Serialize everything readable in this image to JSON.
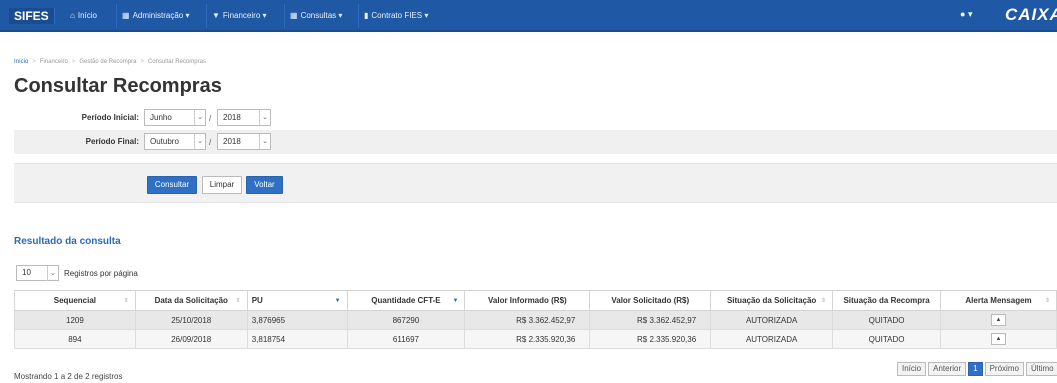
{
  "nav": {
    "brand": "SIFES",
    "items": [
      {
        "label": "Início",
        "icon": "home-icon"
      },
      {
        "label": "Administração ▾",
        "icon": "grid-icon"
      },
      {
        "label": "Financeiro ▾",
        "icon": "cart-icon"
      },
      {
        "label": "Consultas ▾",
        "icon": "table-icon"
      },
      {
        "label": "Contrato FIES ▾",
        "icon": "barcode-icon"
      }
    ],
    "user_label": "▾",
    "logo": "CAIXA"
  },
  "breadcrumb": [
    "Início",
    "Financeiro",
    "Gestão de Recompra",
    "Consultar Recompras"
  ],
  "page_title": "Consultar Recompras",
  "filters": {
    "start": {
      "label": "Período Inicial:",
      "month": "Junho",
      "year": "2018"
    },
    "end": {
      "label": "Período Final:",
      "month": "Outubro",
      "year": "2018"
    },
    "slash": "/"
  },
  "buttons": {
    "consultar": "Consultar",
    "limpar": "Limpar",
    "voltar": "Voltar"
  },
  "results": {
    "title": "Resultado da consulta",
    "page_length": "10",
    "page_length_label": "Registros por página",
    "columns": [
      "Sequencial",
      "Data da Solicitação",
      "PU",
      "Quantidade CFT-E",
      "Valor Informado (R$)",
      "Valor Solicitado (R$)",
      "Situação da Solicitação",
      "Situação da Recompra",
      "Alerta Mensagem"
    ],
    "rows": [
      [
        "1209",
        "25/10/2018",
        "3,876965",
        "867290",
        "R$ 3.362.452,97",
        "R$ 3.362.452,97",
        "AUTORIZADA",
        "QUITADO"
      ],
      [
        "894",
        "26/09/2018",
        "3,818754",
        "611697",
        "R$ 2.335.920,36",
        "R$ 2.335.920,36",
        "AUTORIZADA",
        "QUITADO"
      ]
    ],
    "info": "Mostrando 1 a 2 de 2 registros",
    "pager": {
      "first": "Início",
      "prev": "Anterior",
      "current": "1",
      "next": "Próximo",
      "last": "Último"
    }
  },
  "colors": {
    "navbar": "#1f59a6",
    "accent": "#2a6ab4",
    "button_primary": "#2f6fc4"
  }
}
